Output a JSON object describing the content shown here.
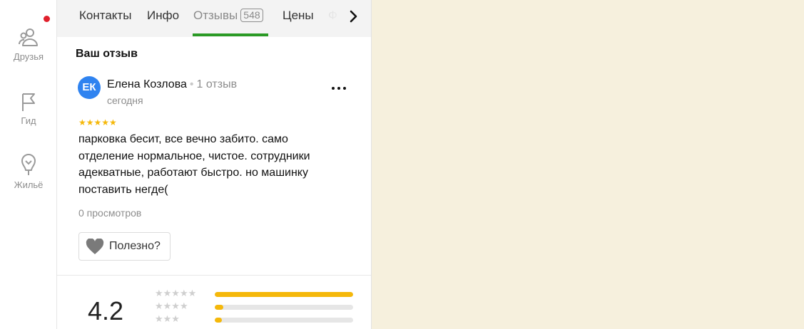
{
  "rail": {
    "friends_label": "Друзья",
    "guide_label": "Гид",
    "housing_label": "Жильё"
  },
  "tabs": {
    "contacts": "Контакты",
    "info": "Инфо",
    "reviews": "Отзывы",
    "reviews_count": "548",
    "prices": "Цены",
    "next_partial": "Ф"
  },
  "review": {
    "section_title": "Ваш отзыв",
    "avatar_initials": "ЕК",
    "author": "Елена Козлова",
    "separator": "•",
    "author_reviews": "1 отзыв",
    "date": "сегодня",
    "stars": "★★★★★",
    "rating": 5,
    "text": "парковка бесит, все вечно забито. само отделение нормальное, чистое. сотрудники адекватные, работают быстро. но машинку поставить негде(",
    "views": "0 просмотров",
    "useful_label": "Полезно?"
  },
  "summary": {
    "rating": "4.2",
    "distribution": [
      {
        "stars": "★★★★★",
        "fraction": 1.0
      },
      {
        "stars": "★★★★",
        "fraction": 0.06
      },
      {
        "stars": "★★★",
        "fraction": 0.05
      }
    ]
  },
  "colors": {
    "accent_green": "#2a9a25",
    "star_yellow": "#f5b80a",
    "avatar_blue": "#2f83f0",
    "notification_red": "#e0202c",
    "map_background": "#f6f0dd"
  }
}
